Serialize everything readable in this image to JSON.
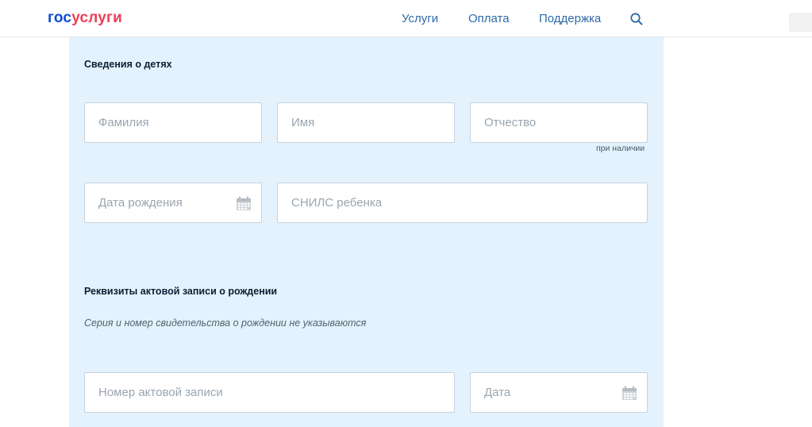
{
  "header": {
    "logo_part1": "гос",
    "logo_part2": "услуги",
    "nav": [
      "Услуги",
      "Оплата",
      "Поддержка"
    ]
  },
  "children_section": {
    "title": "Сведения о детях",
    "surname_placeholder": "Фамилия",
    "name_placeholder": "Имя",
    "patronymic_placeholder": "Отчество",
    "patronymic_hint": "при наличии",
    "birthdate_placeholder": "Дата рождения",
    "snils_placeholder": "СНИЛС ребенка"
  },
  "birth_record_section": {
    "title": "Реквизиты актовой записи о рождении",
    "note": "Серия и номер свидетельства о рождении не указываются",
    "record_number_placeholder": "Номер актовой записи",
    "date_placeholder": "Дата"
  },
  "colors": {
    "brand_blue": "#0d4cd3",
    "brand_red": "#ee3f58",
    "panel_bg": "#e3f2fc",
    "nav_link": "#2e6aa8"
  },
  "icons": [
    "search-icon",
    "calendar-icon"
  ]
}
